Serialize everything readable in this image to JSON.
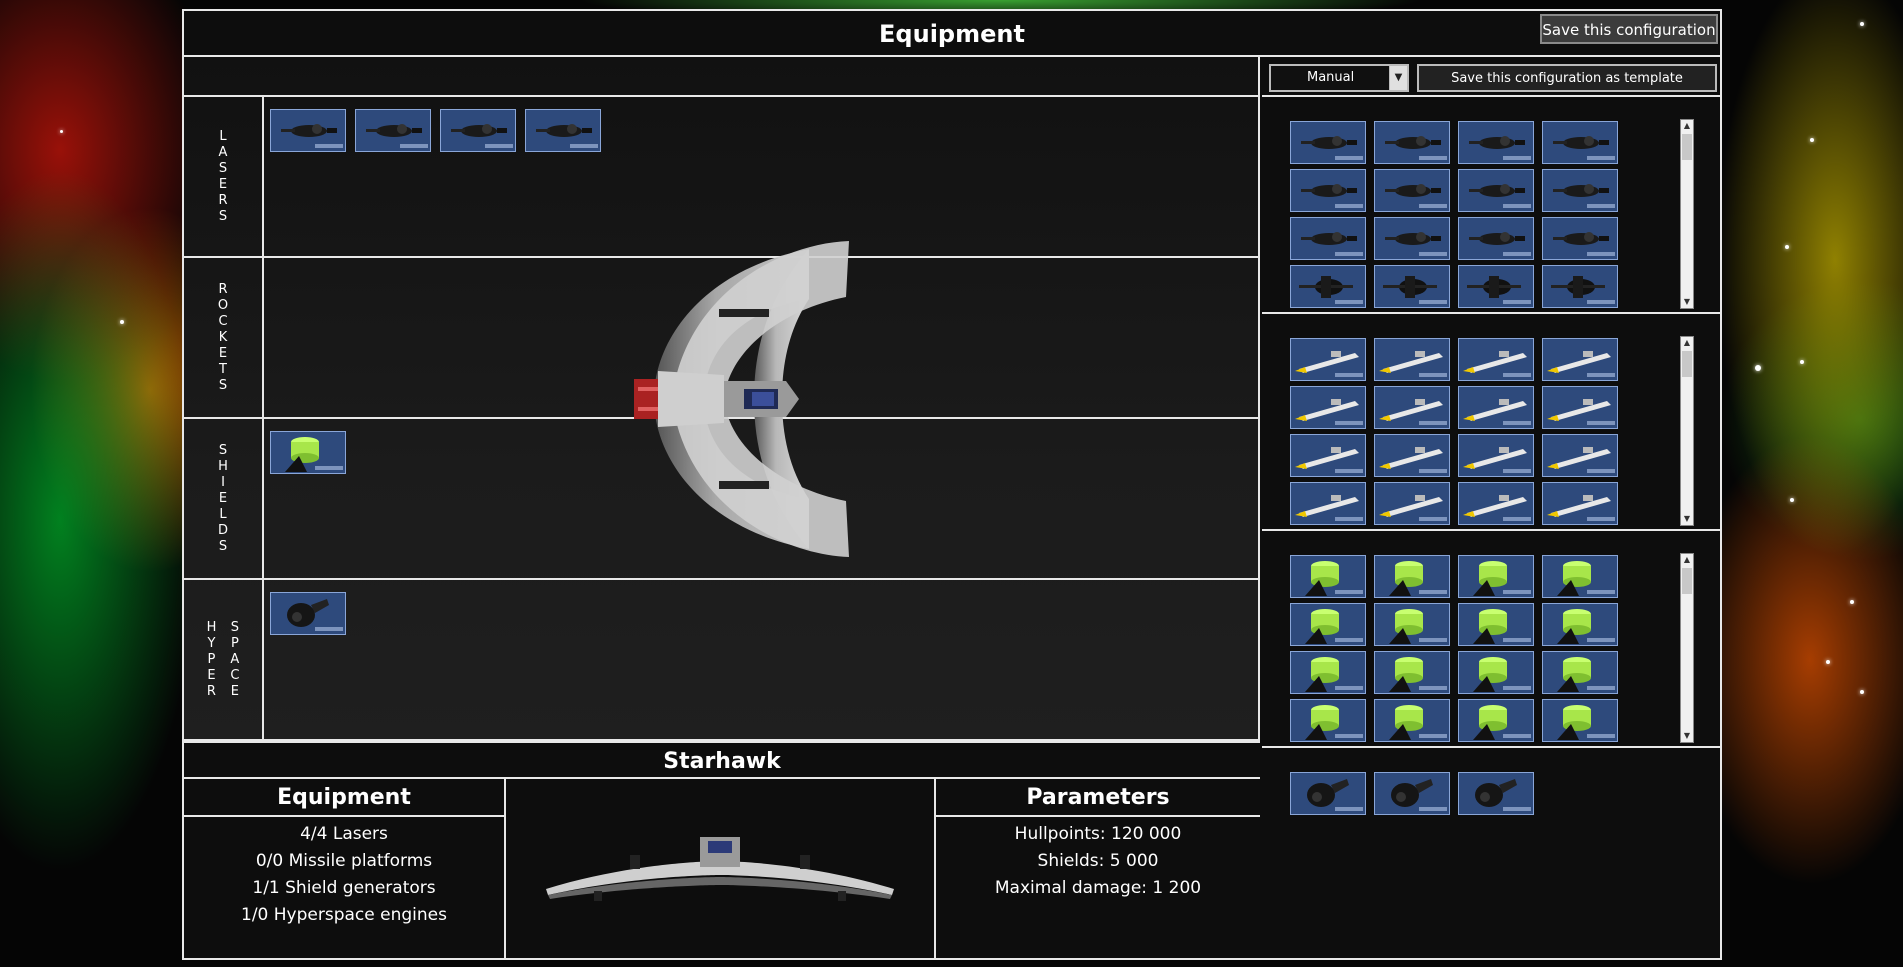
{
  "window": {
    "title": "Equipment",
    "save_button": "Save this configuration"
  },
  "slots": {
    "rows": [
      {
        "label": "LASERS",
        "letters": [
          "L",
          "A",
          "S",
          "E",
          "R",
          "S"
        ],
        "items": [
          "laser",
          "laser",
          "laser",
          "laser"
        ]
      },
      {
        "label": "ROCKETS",
        "letters": [
          "R",
          "O",
          "C",
          "K",
          "E",
          "T",
          "S"
        ],
        "items": []
      },
      {
        "label": "SHIELDS",
        "letters": [
          "S",
          "H",
          "I",
          "E",
          "L",
          "D",
          "S"
        ],
        "items": [
          "shield"
        ]
      },
      {
        "label": "HYPER SPACE",
        "letters_col1": [
          "H",
          "Y",
          "P",
          "E",
          "R"
        ],
        "letters_col2": [
          "S",
          "P",
          "A",
          "C",
          "E"
        ],
        "items": [
          "hyperspace"
        ]
      }
    ]
  },
  "summary": {
    "ship_name": "Starhawk",
    "equipment_heading": "Equipment",
    "equipment_lines": [
      "4/4 Lasers",
      "0/0 Missile platforms",
      "1/1 Shield generators",
      "1/0 Hyperspace engines"
    ],
    "parameters_heading": "Parameters",
    "parameter_lines": [
      "Hullpoints: 120 000",
      "Shields: 5 000",
      "Maximal damage: 1 200"
    ]
  },
  "inventory": {
    "mode_select": "Manual",
    "save_template_button": "Save this configuration as template",
    "panels": [
      {
        "type": "laser",
        "count": 16,
        "variant": "mixed"
      },
      {
        "type": "rocket",
        "count": 16
      },
      {
        "type": "shield",
        "count": 16
      },
      {
        "type": "hyperspace",
        "count": 3
      }
    ]
  },
  "colors": {
    "slot_bg": "#2e4a7c",
    "slot_border": "#8aa6d8",
    "frame": "#e8e8e8",
    "shield_green": "#a8e64a"
  }
}
